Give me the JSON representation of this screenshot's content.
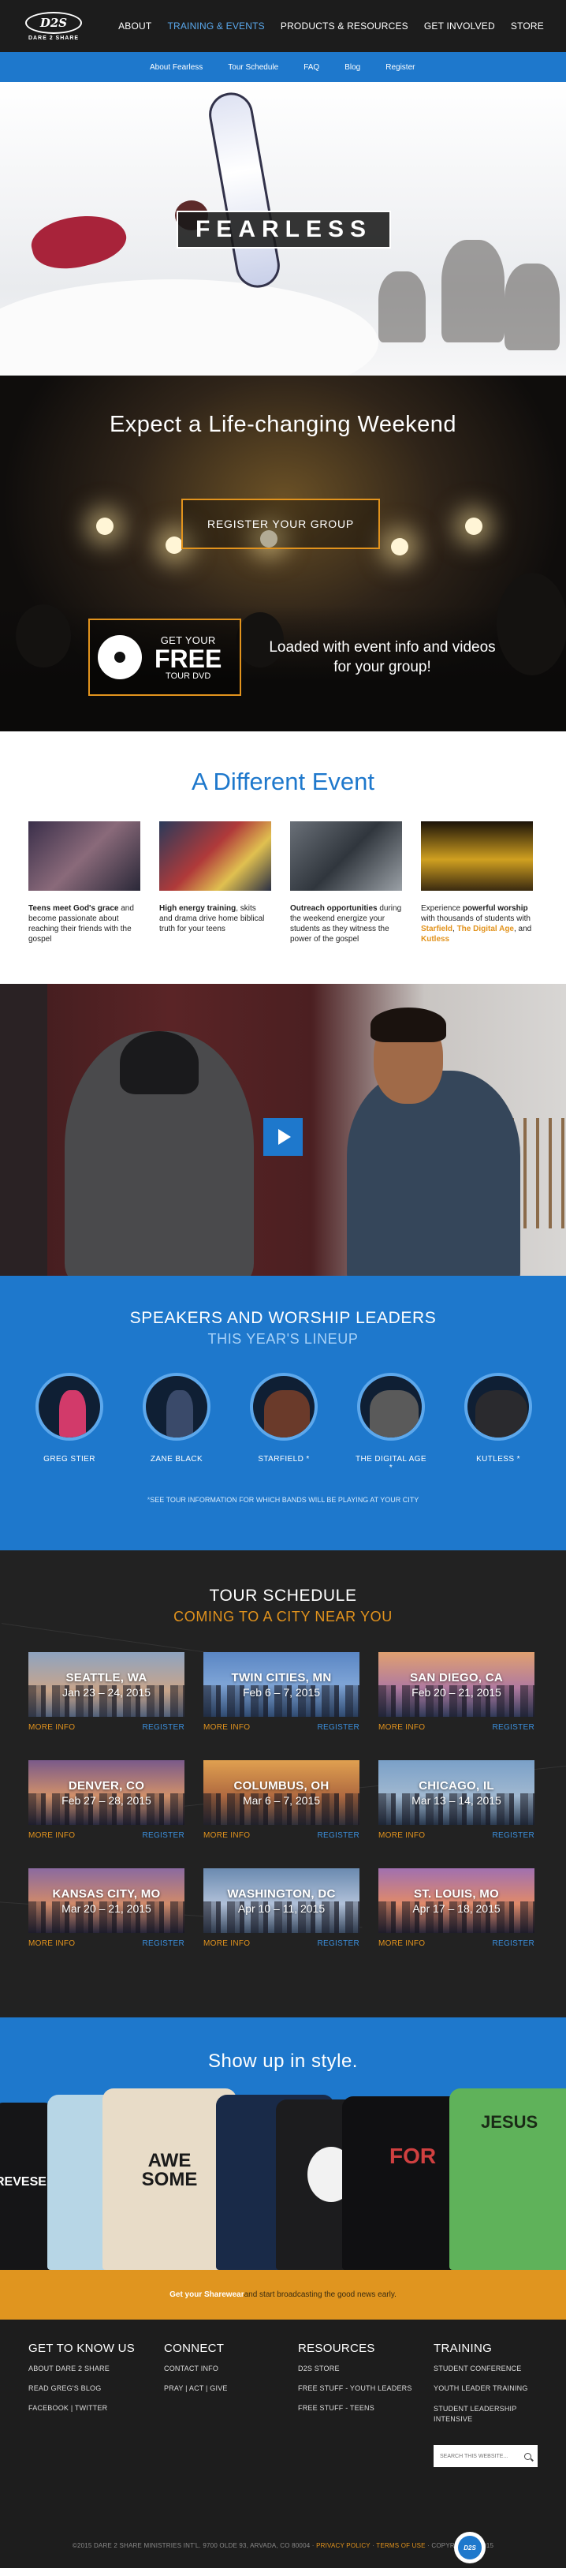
{
  "header": {
    "logo_main": "D2S",
    "logo_sub": "DARE 2 SHARE",
    "nav": [
      "ABOUT",
      "TRAINING & EVENTS",
      "PRODUCTS & RESOURCES",
      "GET INVOLVED",
      "STORE"
    ],
    "active_nav": "TRAINING & EVENTS",
    "accent_color": "#1e78cc"
  },
  "subnav": [
    "About Fearless",
    "Tour Schedule",
    "FAQ",
    "Blog",
    "Register"
  ],
  "hero": {
    "title": "FEARLESS"
  },
  "concert": {
    "headline": "Expect a Life-changing Weekend",
    "register_button": "REGISTER YOUR GROUP",
    "dvd_line1": "GET YOUR",
    "dvd_line2": "FREE",
    "dvd_line3": "TOUR DVD",
    "dvd_description": "Loaded with event info and videos for your group!"
  },
  "different_event": {
    "title": "A Different Event",
    "cards": [
      {
        "bold": "Teens meet God's grace",
        "text": " and become passionate about reaching their friends with the gospel"
      },
      {
        "bold": "High energy training",
        "text": ", skits and drama drive home biblical truth for your teens"
      },
      {
        "bold": "Outreach opportunities",
        "text": " during the weekend energize your students as they witness the power of the gospel"
      },
      {
        "pre": "Experience ",
        "bold": "powerful worship",
        "text": " with thousands of students with ",
        "highlights": [
          "Starfield",
          "The Digital Age",
          "Kutless"
        ]
      }
    ]
  },
  "speakers": {
    "title": "SPEAKERS AND WORSHIP LEADERS",
    "subtitle": "THIS YEAR'S LINEUP",
    "list": [
      "GREG STIER",
      "ZANE BLACK",
      "STARFIELD *",
      "THE DIGITAL AGE *",
      "KUTLESS *"
    ],
    "note": "SEE TOUR INFORMATION FOR WHICH BANDS WILL BE PLAYING AT YOUR CITY"
  },
  "tour": {
    "title": "TOUR SCHEDULE",
    "subtitle": "COMING TO A CITY NEAR YOU",
    "more_label": "MORE INFO",
    "register_label": "REGISTER",
    "cities": [
      {
        "city": "SEATTLE, WA",
        "dates": "Jan 23 – 24, 2015"
      },
      {
        "city": "TWIN CITIES, MN",
        "dates": "Feb 6 – 7, 2015"
      },
      {
        "city": "SAN DIEGO, CA",
        "dates": "Feb 20 – 21, 2015"
      },
      {
        "city": "DENVER, CO",
        "dates": "Feb 27 – 28, 2015"
      },
      {
        "city": "COLUMBUS, OH",
        "dates": "Mar 6 – 7, 2015"
      },
      {
        "city": "CHICAGO, IL",
        "dates": "Mar 13 – 14, 2015"
      },
      {
        "city": "KANSAS CITY, MO",
        "dates": "Mar 20 – 21, 2015"
      },
      {
        "city": "WASHINGTON, DC",
        "dates": "Apr 10 – 11, 2015"
      },
      {
        "city": "ST. LOUIS, MO",
        "dates": "Apr 17 – 18, 2015"
      }
    ]
  },
  "style": {
    "title": "Show up in style.",
    "shirt_texts": [
      "REVESE",
      "AWE SOME",
      "FOR",
      "JESUS"
    ]
  },
  "banner": {
    "highlight": "Get your Sharewear",
    "text": " and start broadcasting the good news early."
  },
  "footer": {
    "col1": {
      "title": "GET TO KNOW US",
      "links": [
        "ABOUT DARE 2 SHARE",
        "READ GREG'S BLOG",
        "FACEBOOK | TWITTER"
      ]
    },
    "col2": {
      "title": "CONNECT",
      "links": [
        "CONTACT INFO",
        "PRAY | ACT | GIVE"
      ]
    },
    "col3": {
      "title": "RESOURCES",
      "links": [
        "D2S STORE",
        "FREE STUFF - YOUTH LEADERS",
        "FREE STUFF - TEENS"
      ]
    },
    "col4": {
      "title": "TRAINING",
      "links": [
        "STUDENT CONFERENCE",
        "YOUTH LEADER TRAINING",
        "STUDENT LEADERSHIP INTENSIVE"
      ]
    },
    "search_placeholder": "SEARCH THIS WEBSITE...",
    "copyright_main": "©2015 DARE 2 SHARE MINISTRIES INT'L. 9700 OLDE 93, ARVADA, CO 80004 · ",
    "privacy": "PRIVACY POLICY",
    "terms": "TERMS OF USE",
    "copyright_end": " · COPYRIGHT © 2015",
    "footer_logo": "D2S"
  }
}
